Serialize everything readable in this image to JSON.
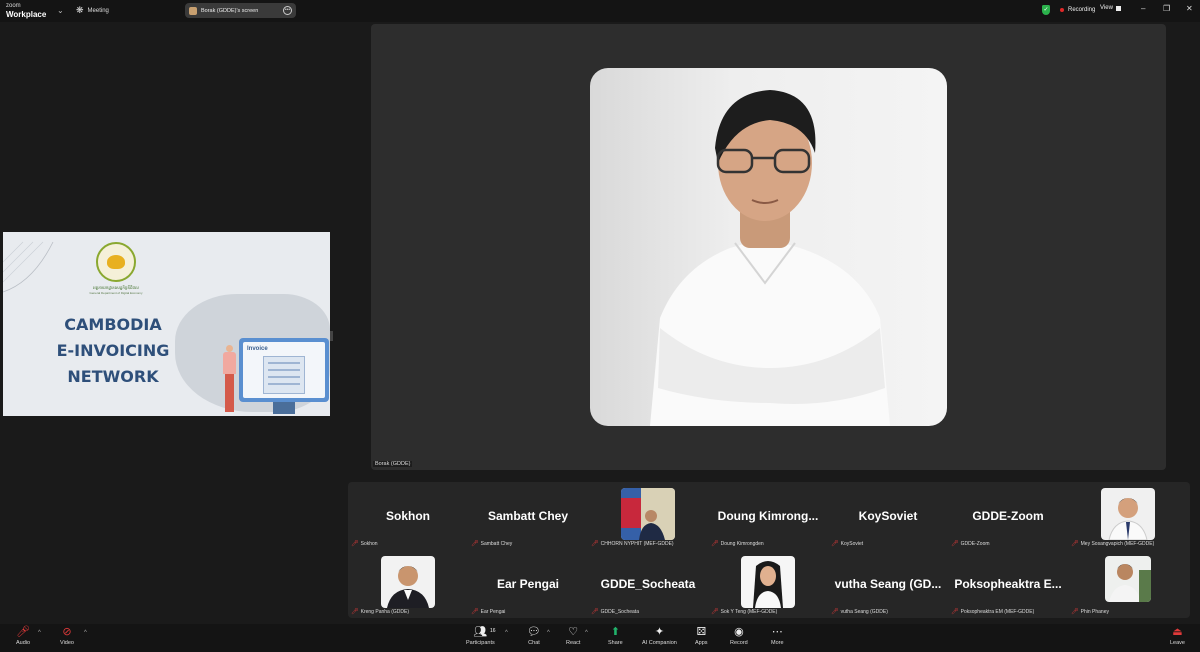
{
  "titlebar": {
    "brand_top": "zoom",
    "brand_bottom": "Workplace",
    "meeting_label": "Meeting",
    "screen_pill_label": "Borak (GDDE)'s screen",
    "recording_label": "Recording",
    "view_label": "View",
    "colors": {
      "recording_shield": "#2bb24c",
      "recording_dot": "#e02828"
    }
  },
  "shared_slide": {
    "title_line1": "CAMBODIA",
    "title_line2": "E-INVOICING",
    "title_line3": "NETWORK",
    "invoice_label": "Invoice",
    "logo_line1": "អគ្គនាយកដ្ឋានសេដ្ឋកិច្ចឌីជីថល",
    "logo_line2": "General Department of Digital Economy",
    "colors": {
      "title": "#2e4f7a",
      "monitor": "#5a8fd0"
    }
  },
  "active_speaker": {
    "name": "Borak (GDDE)"
  },
  "gallery": {
    "tiles": [
      {
        "display": "Sokhon",
        "label": "Sokhon",
        "type": "name"
      },
      {
        "display": "Sambatt Chey",
        "label": "Sambatt Chey",
        "type": "name"
      },
      {
        "display": "",
        "label": "CHHORN NYPHIT (MEF-GDDE)",
        "type": "photo"
      },
      {
        "display": "Doung Kimrong...",
        "label": "Doung Kimrongden",
        "type": "name"
      },
      {
        "display": "KoySoviet",
        "label": "KoySoviet",
        "type": "name"
      },
      {
        "display": "GDDE-Zoom",
        "label": "GDDE-Zoom",
        "type": "name"
      },
      {
        "display": "",
        "label": "Mey Sosangvapich (MEF-GDDE)",
        "type": "photo"
      },
      {
        "display": "",
        "label": "Kreng Panha (GDDE)",
        "type": "photo"
      },
      {
        "display": "Ear Pengai",
        "label": "Ear Pengai",
        "type": "name"
      },
      {
        "display": "GDDE_Socheata",
        "label": "GDDE_Socheata",
        "type": "name"
      },
      {
        "display": "",
        "label": "Sok Y Teng (MEF-GDDE)",
        "type": "photo"
      },
      {
        "display": "vutha Seang (GD...",
        "label": "vutha Seang (GDDE)",
        "type": "name"
      },
      {
        "display": "Poksopheaktra E...",
        "label": "Poksopheaktra EM (MEF-GDDE)",
        "type": "name"
      },
      {
        "display": "",
        "label": "Phin Phaney",
        "type": "photo"
      }
    ]
  },
  "toolbar": {
    "audio": "Audio",
    "video": "Video",
    "participants": "Participants",
    "participants_count": "16",
    "chat": "Chat",
    "react": "React",
    "share": "Share",
    "ai_companion": "AI Companion",
    "apps": "Apps",
    "record": "Record",
    "more": "More",
    "leave": "Leave",
    "icons": [
      "mic-muted-icon",
      "video-off-icon",
      "participants-icon",
      "chat-icon",
      "react-icon",
      "share-icon",
      "ai-companion-icon",
      "apps-icon",
      "record-icon",
      "more-icon",
      "leave-icon"
    ]
  }
}
